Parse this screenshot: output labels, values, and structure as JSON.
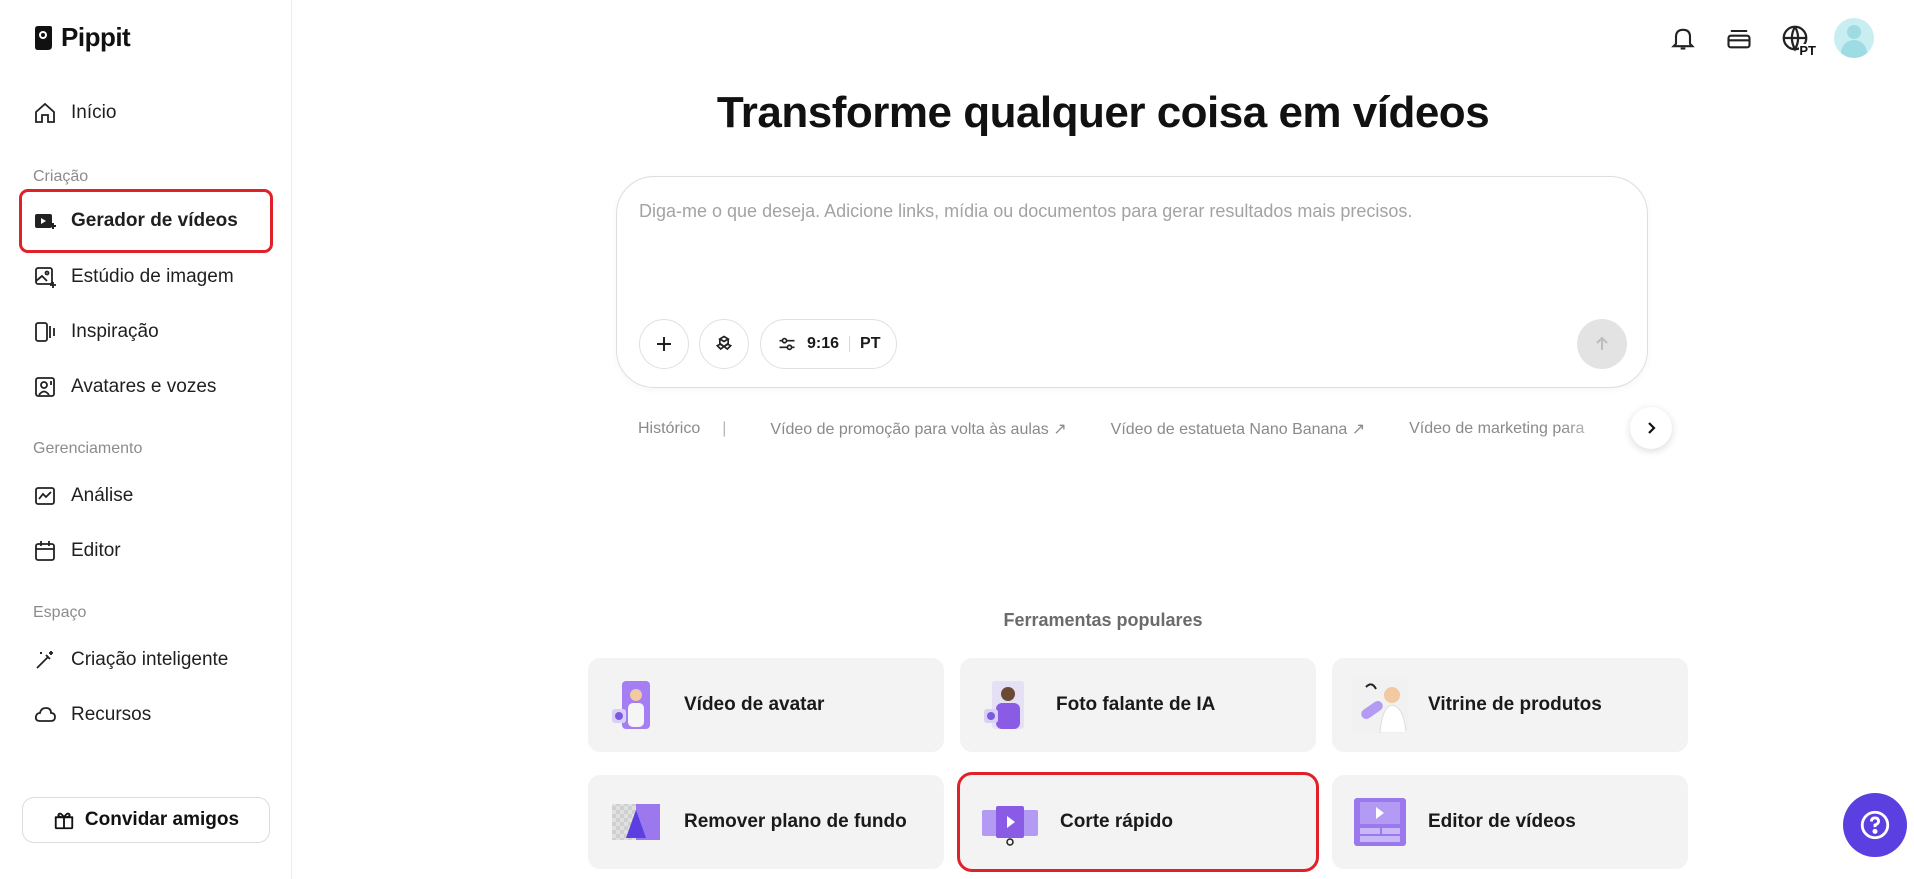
{
  "app": {
    "name": "Pippit"
  },
  "sidebar": {
    "home": "Início",
    "sections": [
      {
        "label": "Criação",
        "items": [
          "Gerador de vídeos",
          "Estúdio de imagem",
          "Inspiração",
          "Avatares e vozes"
        ]
      },
      {
        "label": "Gerenciamento",
        "items": [
          "Análise",
          "Editor"
        ]
      },
      {
        "label": "Espaço",
        "items": [
          "Criação inteligente",
          "Recursos"
        ]
      }
    ],
    "invite": "Convidar amigos"
  },
  "header": {
    "lang": "PT"
  },
  "main": {
    "headline": "Transforme qualquer coisa em vídeos",
    "prompt_placeholder": "Diga-me o que deseja. Adicione links, mídia ou documentos para gerar resultados mais precisos.",
    "settings": {
      "ratio": "9:16",
      "lang": "PT"
    },
    "suggestions": {
      "history": "Histórico",
      "separator": "|",
      "items": [
        "Vídeo de promoção para volta às aulas ↗",
        "Vídeo de estatueta Nano Banana ↗",
        "Vídeo de marketing para"
      ]
    },
    "tools_title": "Ferramentas populares",
    "tools": [
      "Vídeo de avatar",
      "Foto falante de IA",
      "Vitrine de produtos",
      "Remover plano de fundo",
      "Corte rápido",
      "Editor de vídeos"
    ]
  },
  "colors": {
    "accent": "#5b3fe0",
    "highlight": "#e02129"
  }
}
